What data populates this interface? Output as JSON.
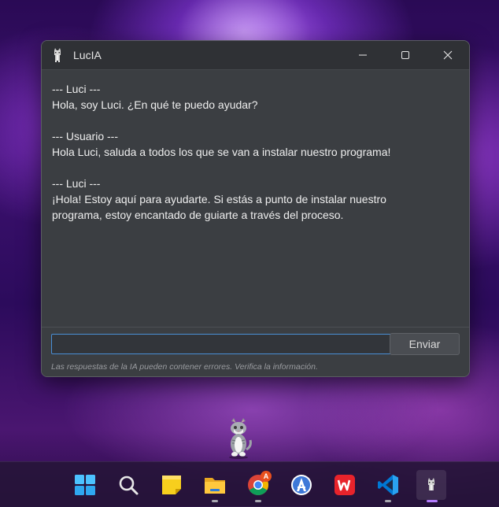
{
  "window": {
    "title": "LucIA",
    "controls": {
      "minimize": "minimize-icon",
      "maximize": "maximize-icon",
      "close": "close-icon"
    }
  },
  "chat": {
    "messages": [
      {
        "header": "--- Luci ---",
        "text": "Hola, soy Luci. ¿En qué te puedo ayudar?"
      },
      {
        "header": "--- Usuario ---",
        "text": "Hola Luci, saluda a todos los que se van a instalar nuestro programa!"
      },
      {
        "header": "--- Luci ---",
        "text": "¡Hola! Estoy aquí para ayudarte. Si estás a punto de instalar nuestro\nprograma, estoy encantado de guiarte a través del proceso."
      }
    ]
  },
  "input": {
    "value": "",
    "placeholder": ""
  },
  "send_label": "Enviar",
  "disclaimer": "Las respuestas de la IA pueden contener errores. Verifica la información.",
  "taskbar": {
    "items": [
      {
        "name": "start-icon",
        "running": false
      },
      {
        "name": "search-icon",
        "running": false
      },
      {
        "name": "sticky-notes-icon",
        "running": false
      },
      {
        "name": "file-explorer-icon",
        "running": true
      },
      {
        "name": "chrome-icon",
        "running": true,
        "badge": "A"
      },
      {
        "name": "android-studio-icon",
        "running": false
      },
      {
        "name": "wps-office-icon",
        "running": false
      },
      {
        "name": "vscode-icon",
        "running": true
      },
      {
        "name": "lucia-cat-icon",
        "running": true,
        "active": true
      }
    ]
  },
  "colors": {
    "window_bg": "#3b3e42",
    "titlebar_bg": "#2f3135",
    "input_border": "#4a8fd6",
    "accent": "#b47cff"
  }
}
